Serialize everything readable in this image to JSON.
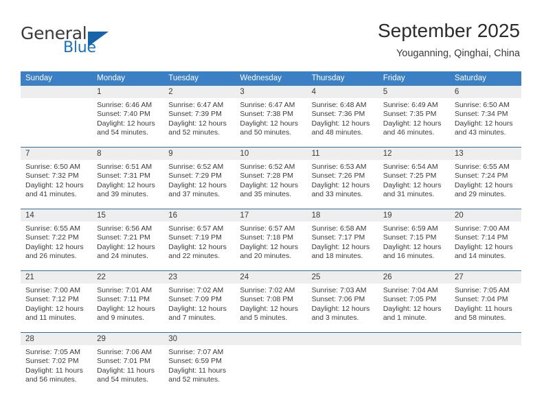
{
  "logo": {
    "word1": "General",
    "word2": "Blue",
    "triangle_color": "#1565a8",
    "blue_color": "#1c73b8"
  },
  "header": {
    "title": "September 2025",
    "subtitle": "Youganning, Qinghai, China"
  },
  "theme": {
    "header_bar": "#3b7fc4",
    "daynum_band": "#eeeeee",
    "separator": "#2e6da6",
    "text": "#3a3a3a"
  },
  "weekdays": [
    "Sunday",
    "Monday",
    "Tuesday",
    "Wednesday",
    "Thursday",
    "Friday",
    "Saturday"
  ],
  "labels": {
    "sunrise": "Sunrise:",
    "sunset": "Sunset:",
    "daylight": "Daylight:"
  },
  "weeks": [
    [
      {
        "day": "",
        "sunrise": "",
        "sunset": "",
        "daylight": ""
      },
      {
        "day": "1",
        "sunrise": "Sunrise: 6:46 AM",
        "sunset": "Sunset: 7:40 PM",
        "daylight": "Daylight: 12 hours and 54 minutes."
      },
      {
        "day": "2",
        "sunrise": "Sunrise: 6:47 AM",
        "sunset": "Sunset: 7:39 PM",
        "daylight": "Daylight: 12 hours and 52 minutes."
      },
      {
        "day": "3",
        "sunrise": "Sunrise: 6:47 AM",
        "sunset": "Sunset: 7:38 PM",
        "daylight": "Daylight: 12 hours and 50 minutes."
      },
      {
        "day": "4",
        "sunrise": "Sunrise: 6:48 AM",
        "sunset": "Sunset: 7:36 PM",
        "daylight": "Daylight: 12 hours and 48 minutes."
      },
      {
        "day": "5",
        "sunrise": "Sunrise: 6:49 AM",
        "sunset": "Sunset: 7:35 PM",
        "daylight": "Daylight: 12 hours and 46 minutes."
      },
      {
        "day": "6",
        "sunrise": "Sunrise: 6:50 AM",
        "sunset": "Sunset: 7:34 PM",
        "daylight": "Daylight: 12 hours and 43 minutes."
      }
    ],
    [
      {
        "day": "7",
        "sunrise": "Sunrise: 6:50 AM",
        "sunset": "Sunset: 7:32 PM",
        "daylight": "Daylight: 12 hours and 41 minutes."
      },
      {
        "day": "8",
        "sunrise": "Sunrise: 6:51 AM",
        "sunset": "Sunset: 7:31 PM",
        "daylight": "Daylight: 12 hours and 39 minutes."
      },
      {
        "day": "9",
        "sunrise": "Sunrise: 6:52 AM",
        "sunset": "Sunset: 7:29 PM",
        "daylight": "Daylight: 12 hours and 37 minutes."
      },
      {
        "day": "10",
        "sunrise": "Sunrise: 6:52 AM",
        "sunset": "Sunset: 7:28 PM",
        "daylight": "Daylight: 12 hours and 35 minutes."
      },
      {
        "day": "11",
        "sunrise": "Sunrise: 6:53 AM",
        "sunset": "Sunset: 7:26 PM",
        "daylight": "Daylight: 12 hours and 33 minutes."
      },
      {
        "day": "12",
        "sunrise": "Sunrise: 6:54 AM",
        "sunset": "Sunset: 7:25 PM",
        "daylight": "Daylight: 12 hours and 31 minutes."
      },
      {
        "day": "13",
        "sunrise": "Sunrise: 6:55 AM",
        "sunset": "Sunset: 7:24 PM",
        "daylight": "Daylight: 12 hours and 29 minutes."
      }
    ],
    [
      {
        "day": "14",
        "sunrise": "Sunrise: 6:55 AM",
        "sunset": "Sunset: 7:22 PM",
        "daylight": "Daylight: 12 hours and 26 minutes."
      },
      {
        "day": "15",
        "sunrise": "Sunrise: 6:56 AM",
        "sunset": "Sunset: 7:21 PM",
        "daylight": "Daylight: 12 hours and 24 minutes."
      },
      {
        "day": "16",
        "sunrise": "Sunrise: 6:57 AM",
        "sunset": "Sunset: 7:19 PM",
        "daylight": "Daylight: 12 hours and 22 minutes."
      },
      {
        "day": "17",
        "sunrise": "Sunrise: 6:57 AM",
        "sunset": "Sunset: 7:18 PM",
        "daylight": "Daylight: 12 hours and 20 minutes."
      },
      {
        "day": "18",
        "sunrise": "Sunrise: 6:58 AM",
        "sunset": "Sunset: 7:17 PM",
        "daylight": "Daylight: 12 hours and 18 minutes."
      },
      {
        "day": "19",
        "sunrise": "Sunrise: 6:59 AM",
        "sunset": "Sunset: 7:15 PM",
        "daylight": "Daylight: 12 hours and 16 minutes."
      },
      {
        "day": "20",
        "sunrise": "Sunrise: 7:00 AM",
        "sunset": "Sunset: 7:14 PM",
        "daylight": "Daylight: 12 hours and 14 minutes."
      }
    ],
    [
      {
        "day": "21",
        "sunrise": "Sunrise: 7:00 AM",
        "sunset": "Sunset: 7:12 PM",
        "daylight": "Daylight: 12 hours and 11 minutes."
      },
      {
        "day": "22",
        "sunrise": "Sunrise: 7:01 AM",
        "sunset": "Sunset: 7:11 PM",
        "daylight": "Daylight: 12 hours and 9 minutes."
      },
      {
        "day": "23",
        "sunrise": "Sunrise: 7:02 AM",
        "sunset": "Sunset: 7:09 PM",
        "daylight": "Daylight: 12 hours and 7 minutes."
      },
      {
        "day": "24",
        "sunrise": "Sunrise: 7:02 AM",
        "sunset": "Sunset: 7:08 PM",
        "daylight": "Daylight: 12 hours and 5 minutes."
      },
      {
        "day": "25",
        "sunrise": "Sunrise: 7:03 AM",
        "sunset": "Sunset: 7:06 PM",
        "daylight": "Daylight: 12 hours and 3 minutes."
      },
      {
        "day": "26",
        "sunrise": "Sunrise: 7:04 AM",
        "sunset": "Sunset: 7:05 PM",
        "daylight": "Daylight: 12 hours and 1 minute."
      },
      {
        "day": "27",
        "sunrise": "Sunrise: 7:05 AM",
        "sunset": "Sunset: 7:04 PM",
        "daylight": "Daylight: 11 hours and 58 minutes."
      }
    ],
    [
      {
        "day": "28",
        "sunrise": "Sunrise: 7:05 AM",
        "sunset": "Sunset: 7:02 PM",
        "daylight": "Daylight: 11 hours and 56 minutes."
      },
      {
        "day": "29",
        "sunrise": "Sunrise: 7:06 AM",
        "sunset": "Sunset: 7:01 PM",
        "daylight": "Daylight: 11 hours and 54 minutes."
      },
      {
        "day": "30",
        "sunrise": "Sunrise: 7:07 AM",
        "sunset": "Sunset: 6:59 PM",
        "daylight": "Daylight: 11 hours and 52 minutes."
      },
      {
        "day": "",
        "sunrise": "",
        "sunset": "",
        "daylight": ""
      },
      {
        "day": "",
        "sunrise": "",
        "sunset": "",
        "daylight": ""
      },
      {
        "day": "",
        "sunrise": "",
        "sunset": "",
        "daylight": ""
      },
      {
        "day": "",
        "sunrise": "",
        "sunset": "",
        "daylight": ""
      }
    ]
  ]
}
